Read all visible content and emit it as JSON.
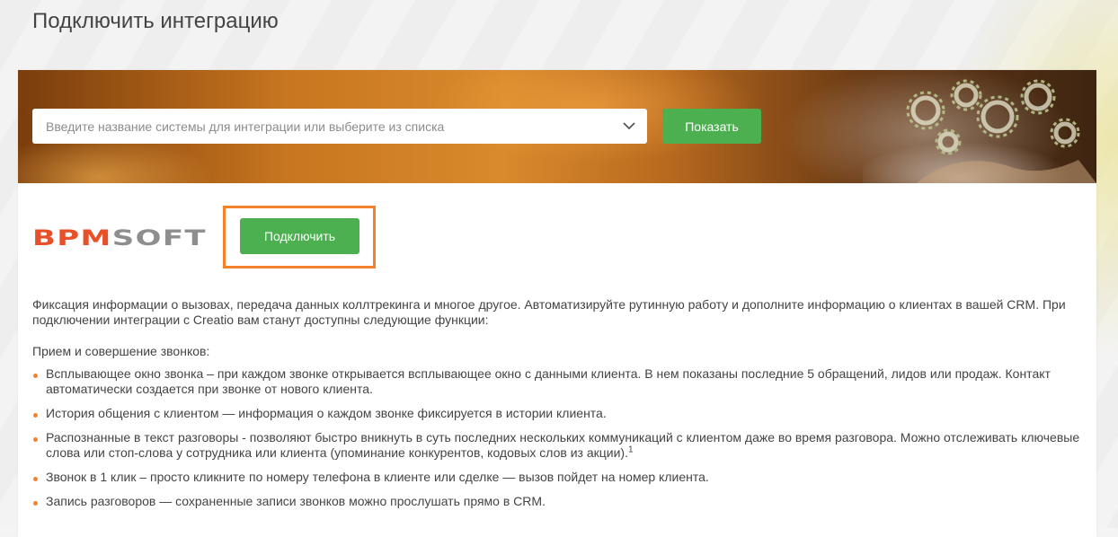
{
  "page": {
    "title": "Подключить интеграцию"
  },
  "search": {
    "placeholder": "Введите название системы для интеграции или выберите из списка",
    "show_label": "Показать"
  },
  "integration": {
    "logo_text": "BPMSOFT",
    "connect_label": "Подключить"
  },
  "description": {
    "intro": "Фиксация информации о вызовах, передача данных коллтрекинга и многое другое. Автоматизируйте рутинную работу и дополните информацию о клиентах в вашей CRM. При подключении интеграции с Creatio вам станут доступны следующие функции:",
    "subhead": "Прием и совершение звонков:",
    "features": [
      "Всплывающее окно звонка – при каждом звонке открывается всплывающее окно с данными клиента. В нем показаны последние 5 обращений, лидов или продаж. Контакт автоматически создается при звонке от нового клиента.",
      "История общения с клиентом — информация о каждом звонке фиксируется в истории клиента.",
      "Распознанные в текст разговоры - позволяют быстро вникнуть в суть последних нескольких коммуникаций с клиентом даже во время разговора. Можно отслеживать ключевые слова или стоп-слова у сотрудника или клиента (упоминание конкурентов, кодовых слов из акции).",
      "Звонок в 1 клик – просто кликните по номеру телефона в клиенте или сделке — вызов пойдет на номер клиента.",
      "Запись разговоров — сохраненные записи звонков можно прослушать прямо в CRM."
    ],
    "footnote_mark": "1"
  },
  "colors": {
    "accent_orange": "#f5822a",
    "button_green": "#4caf50"
  }
}
